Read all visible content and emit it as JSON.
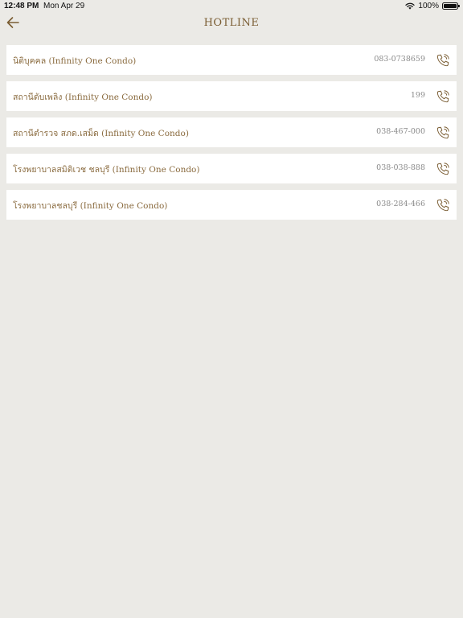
{
  "status_bar": {
    "time": "12:48 PM",
    "date": "Mon Apr 29",
    "battery": "100%",
    "battery_level": 1.0,
    "icons": [
      "wifi-icon",
      "battery-icon"
    ]
  },
  "header": {
    "title": "HOTLINE",
    "back_icon": "arrow-left-icon"
  },
  "colors": {
    "background": "#ebeae6",
    "accent": "#7a5d33",
    "row_text": "#8a6b3f",
    "number_text": "#8a8a8a",
    "row_background": "#ffffff"
  },
  "hotlines": [
    {
      "name": "นิติบุคคล (Infinity One Condo)",
      "number": "083-0738659",
      "icon": "phone-call-icon"
    },
    {
      "name": "สถานีดับเพลิง (Infinity One Condo)",
      "number": "199",
      "icon": "phone-call-icon"
    },
    {
      "name": "สถานีตำรวจ สภด.เสม็ด (Infinity One Condo)",
      "number": "038-467-000",
      "icon": "phone-call-icon"
    },
    {
      "name": "โรงพยาบาลสมิติเวช ชลบุรี (Infinity One Condo)",
      "number": "038-038-888",
      "icon": "phone-call-icon"
    },
    {
      "name": "โรงพยาบาลชลบุรี (Infinity One Condo)",
      "number": "038-284-466",
      "icon": "phone-call-icon"
    }
  ]
}
